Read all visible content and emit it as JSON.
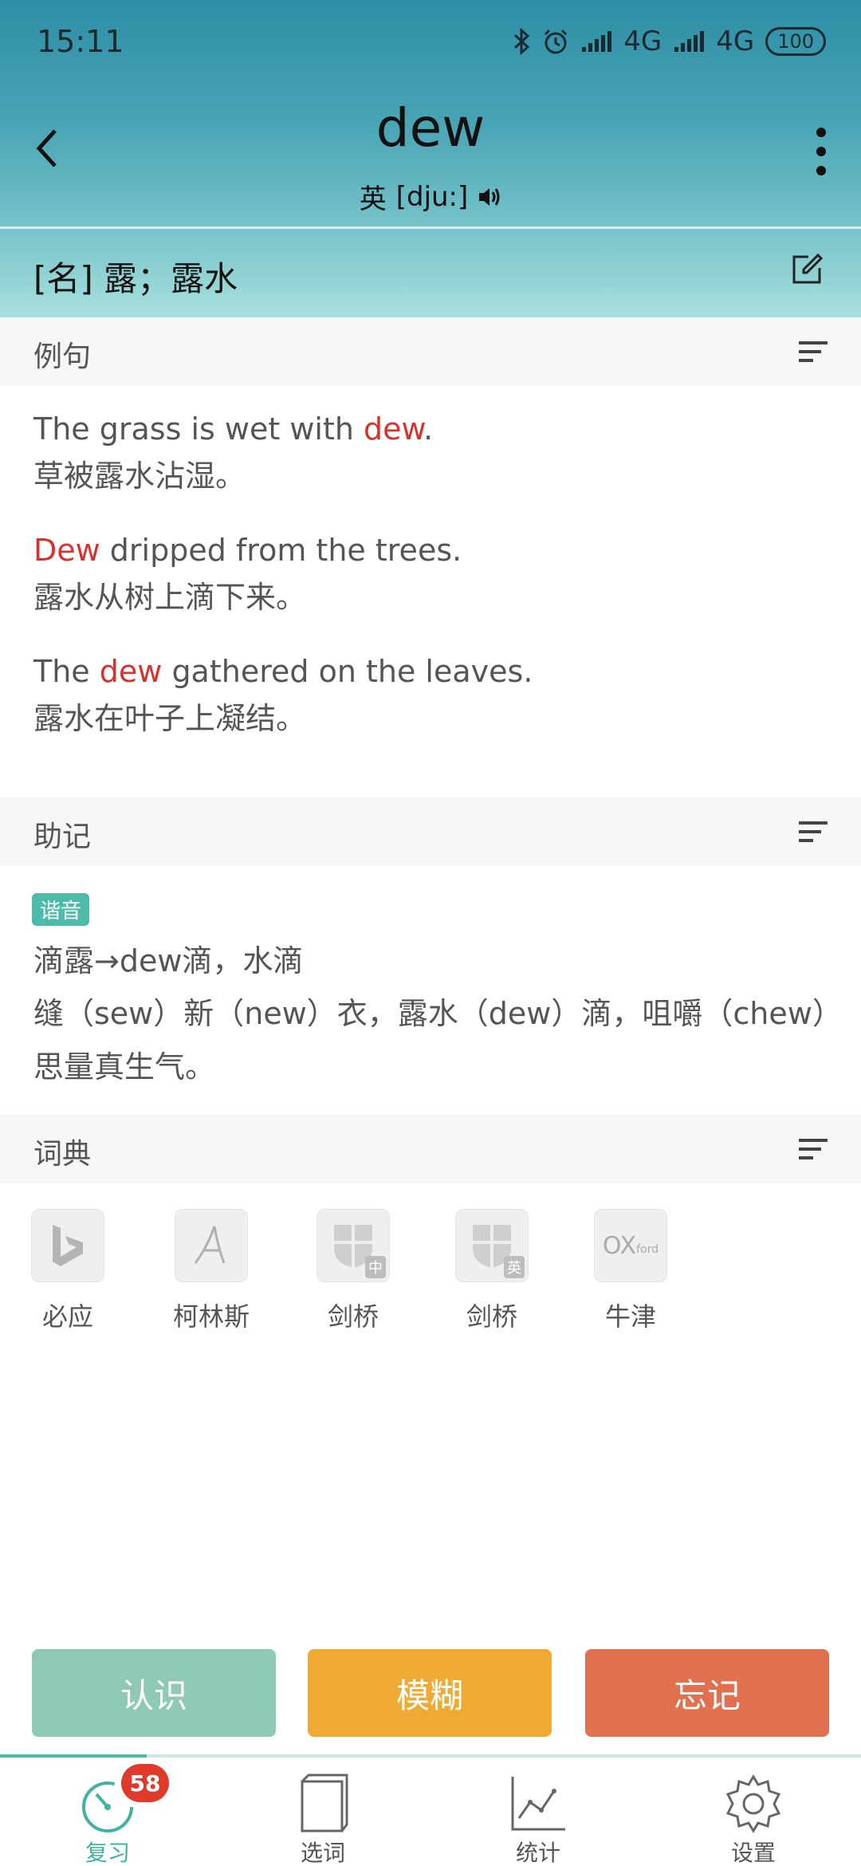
{
  "status_bar": {
    "time": "15:11",
    "network1": "4G",
    "network2": "4G",
    "battery": "100"
  },
  "header": {
    "word": "dew",
    "phonetic_region": "英",
    "phonetic": "[dju:]"
  },
  "meaning": "[名] 露；露水",
  "sections": {
    "examples_title": "例句",
    "mnemonic_title": "助记",
    "dictionary_title": "词典"
  },
  "examples": [
    {
      "en_before": "The grass is wet with ",
      "en_hl": "dew",
      "en_after": ".",
      "cn": "草被露水沾湿。"
    },
    {
      "en_before": "",
      "en_hl": "Dew",
      "en_after": " dripped from the trees.",
      "cn": "露水从树上滴下来。"
    },
    {
      "en_before": "The ",
      "en_hl": "dew",
      "en_after": " gathered on the leaves.",
      "cn": "露水在叶子上凝结。"
    }
  ],
  "mnemonic": {
    "tag": "谐音",
    "line1": "滴露→dew滴，水滴",
    "line2": "缝（sew）新（new）衣，露水（dew）滴，咀嚼（chew）思量真生气。"
  },
  "dictionaries": [
    {
      "name": "必应",
      "icon": "bing-icon"
    },
    {
      "name": "柯林斯",
      "icon": "collins-icon"
    },
    {
      "name": "剑桥",
      "icon": "cambridge-icon",
      "badge": "中"
    },
    {
      "name": "剑桥",
      "icon": "cambridge-icon",
      "badge": "英"
    },
    {
      "name": "牛津",
      "icon": "oxford-icon",
      "text": "OX",
      "text_small": "ford"
    }
  ],
  "actions": {
    "know": "认识",
    "vague": "模糊",
    "forget": "忘记"
  },
  "progress": 0.17,
  "tabs": [
    {
      "label": "复习",
      "badge": "58",
      "icon": "review-timer-icon",
      "active": true
    },
    {
      "label": "选词",
      "icon": "book-icon"
    },
    {
      "label": "统计",
      "icon": "chart-icon"
    },
    {
      "label": "设置",
      "icon": "settings-gear-icon"
    }
  ],
  "colors": {
    "accent": "#4cbca8",
    "highlight": "#d8322f",
    "know": "#8ec9b6",
    "vague": "#eeaa33",
    "forget": "#e07050"
  }
}
